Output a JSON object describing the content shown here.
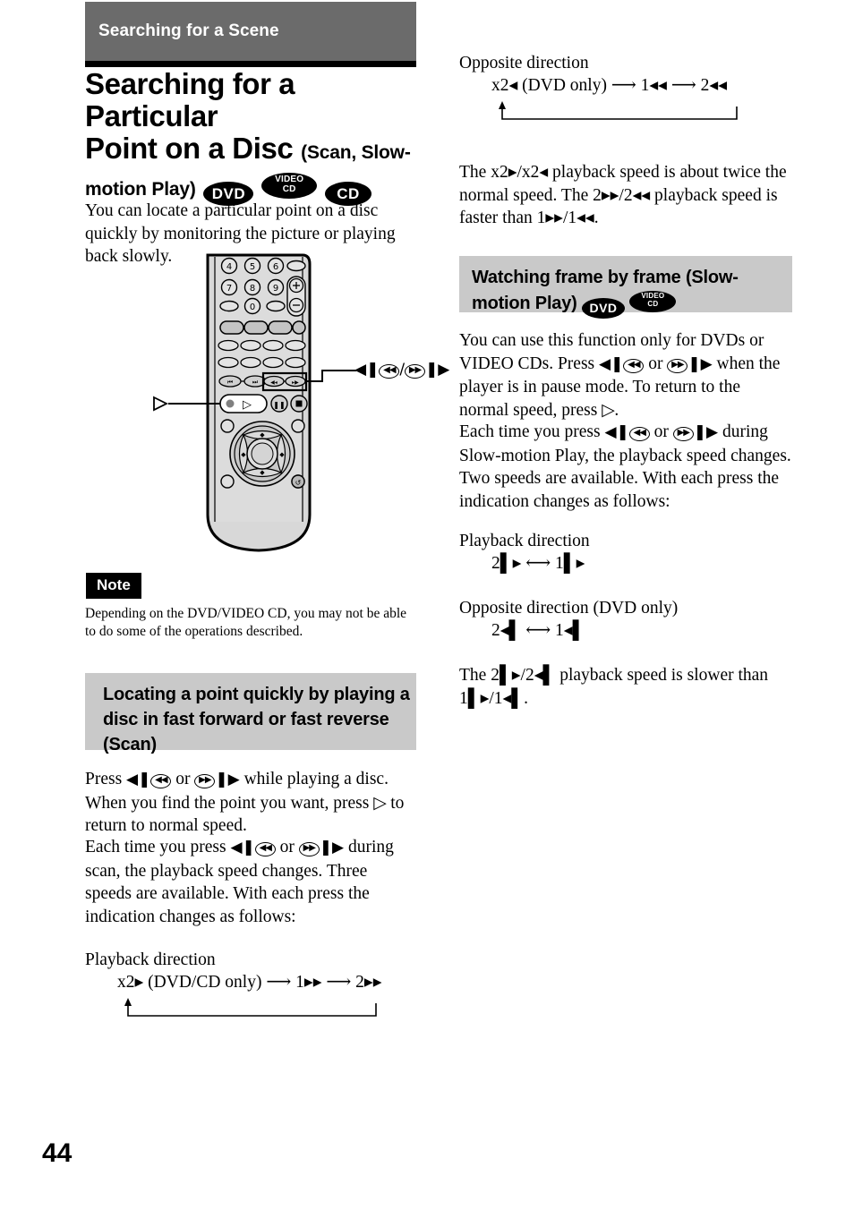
{
  "page": {
    "number": "44",
    "chapter_title": "Searching for a Scene",
    "header_bg": "#6b6b6b",
    "subhead_bg": "#c9c9c9"
  },
  "title": {
    "line1": "Searching for a Particular",
    "line2_main": "Point on a Disc",
    "line2_sub": "(Scan, Slow-",
    "line3_sub": "motion Play)",
    "badges": [
      "DVD",
      "VIDEO CD",
      "CD"
    ]
  },
  "intro": {
    "text": "You can locate a particular point on a disc quickly by monitoring the picture or playing back slowly."
  },
  "remote": {
    "caption_play": "play-button-callout",
    "caption_scan": "scan-buttons-callout",
    "keypad": [
      "4",
      "5",
      "6",
      "7",
      "8",
      "9",
      "0"
    ],
    "volume_plus": "+",
    "volume_minus": "-"
  },
  "note": {
    "label": "Note",
    "text": "Depending on the DVD/VIDEO CD, you may not be able to do some of the operations described."
  },
  "scan_section": {
    "heading": "Locating a point quickly by playing a disc in fast forward or fast reverse (Scan)",
    "para1_a": "Press",
    "para1_b": "or",
    "para1_c": "while playing a disc. When you find the point you want, press",
    "para1_d": "to return to normal speed.",
    "para2_a": "Each time you press",
    "para2_b": "or",
    "para2_c": "during scan, the playback speed changes. Three speeds are available. With each press the indication changes as follows:",
    "playback_label": "Playback direction",
    "playback_seq": "x2▸ (DVD/CD only)  ⟶  1▸▸  ⟶  2▸▸",
    "opposite_label": "Opposite direction",
    "opposite_seq": "x2◂ (DVD only)  ⟶  1◂◂  ⟶  2◂◂",
    "speed_note_a": "The x2▸/x2◂ playback speed is about twice the normal speed. The 2▸▸/2◂◂ playback speed is faster than 1▸▸/1◂◂."
  },
  "slow_section": {
    "heading_line1": "Watching frame by frame (Slow-",
    "heading_line2": "motion Play)",
    "badges": [
      "DVD",
      "VIDEO CD"
    ],
    "para1_a": "You can use this function only for DVDs or VIDEO CDs. Press",
    "para1_b": "or",
    "para1_c": "when the player is in pause mode. To return to the normal speed, press",
    "para1_d": ".",
    "para2_a": "Each time you press",
    "para2_b": "or",
    "para2_c": "during Slow-motion Play, the playback speed changes. Two speeds are available. With each press the indication changes as follows:",
    "playback_label": "Playback direction",
    "playback_seq": "2▌▸  ⟷  1▌▸",
    "opposite_label": "Opposite direction (DVD only)",
    "opposite_seq": "2◂▌  ⟷  1◂▌",
    "speed_note": "The 2▌▸/2◂▌ playback speed is slower than 1▌▸/1◂▌."
  }
}
